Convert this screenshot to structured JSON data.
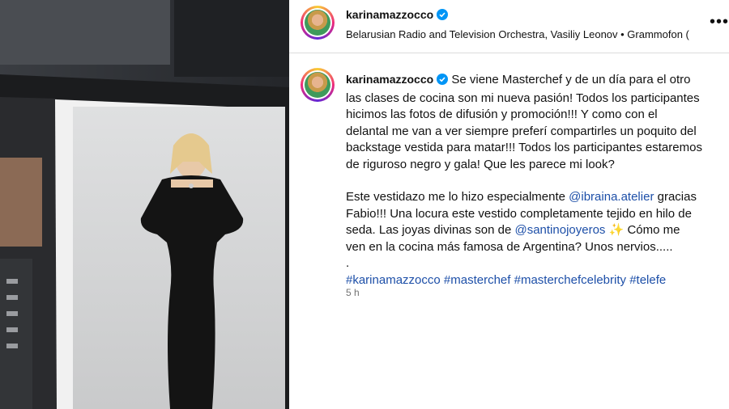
{
  "header": {
    "username": "karinamazzocco",
    "audio": "Belarusian Radio and Television Orchestra, Vasiliy Leonov • Grammofon ("
  },
  "caption": {
    "username": "karinamazzocco",
    "p1": "Se viene Masterchef y de un día para el otro las clases de cocina son mi nueva pasión! Todos los participantes hicimos las fotos de difusión y promoción!!! Y como con el delantal me van a ver siempre preferí compartirles un poquito del backstage vestida para matar!!! Todos los participantes estaremos de riguroso negro y gala! Que les parece mi look?",
    "p2_a": "Este vestidazo me lo hizo especialmente",
    "mention1": "@ibraina.atelier",
    "p2_b": "gracias Fabio!!! Una locura este vestido completamente tejido en hilo de seda. Las joyas divinas son de",
    "mention2": "@santinojoyeros",
    "sparkle": "✨",
    "p2_c": "Cómo me ven en la cocina más famosa de Argentina? Unos nervios.....",
    "dot": ".",
    "hashtags": [
      "#karinamazzocco",
      "#masterchef",
      "#masterchefcelebrity",
      "#telefe"
    ]
  },
  "timestamp": "5 h",
  "colors": {
    "link": "#1d4fa8",
    "verified": "#0095f6"
  },
  "icons": [
    "verified-badge-icon",
    "more-options-icon"
  ]
}
